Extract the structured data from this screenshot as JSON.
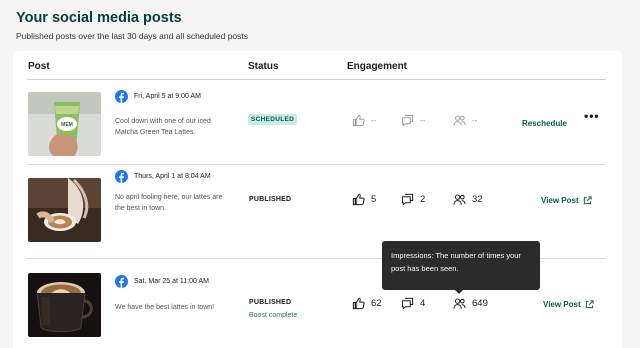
{
  "page": {
    "title": "Your social media posts",
    "subtitle": "Published posts over the last 30 days and all scheduled posts"
  },
  "table": {
    "headers": {
      "post": "Post",
      "status": "Status",
      "engagement": "Engagement"
    }
  },
  "posts": [
    {
      "network_icon": "facebook-icon",
      "date": "Fri, April 5 at 9:00 AM",
      "text": "Cool down with one of our iced Matcha Green Tea Lattes.",
      "status": "SCHEDULED",
      "likes": "--",
      "comments": "--",
      "impressions": "--",
      "action": "Reschedule",
      "more": "•••"
    },
    {
      "network_icon": "facebook-icon",
      "date": "Thurs, April 1 at 8:04 AM",
      "text": "No april fooling here, our lattes are the best in town.",
      "status": "PUBLISHED",
      "likes": "5",
      "comments": "2",
      "impressions": "32",
      "action": "View Post"
    },
    {
      "network_icon": "facebook-icon",
      "date": "Sat, Mar 25 at 11:00 AM",
      "text": "We have the best lattes in town!",
      "status": "PUBLISHED",
      "boost_status": "Boost complete",
      "likes": "62",
      "comments": "4",
      "impressions": "649",
      "action": "View Post"
    }
  ],
  "tooltip": {
    "text": "Impressions: The number of times your post has been seen."
  },
  "colors": {
    "accent": "#0b5b4b",
    "scheduled_badge_bg": "#c8ece3",
    "boost_green": "#1f7a45",
    "facebook_blue": "#1877f2"
  }
}
